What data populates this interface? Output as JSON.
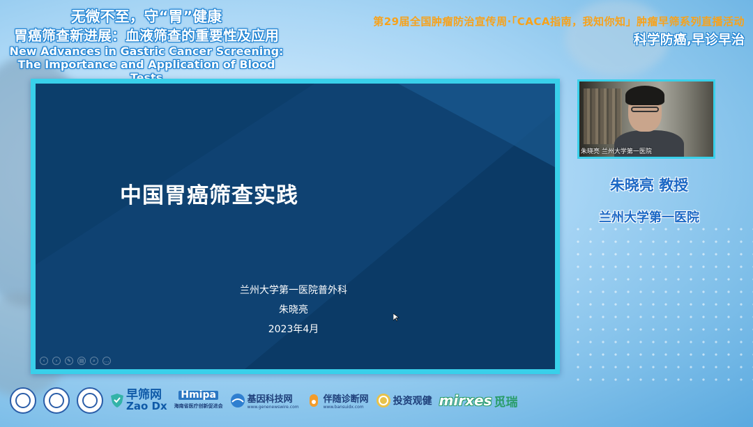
{
  "header": {
    "left_line1": "无微不至，守“胃”健康",
    "left_line2": "胃癌筛查新进展：血液筛查的重要性及应用",
    "left_line3": "New Advances in Gastric Cancer Screening:",
    "left_line4": "The Importance and Application of Blood Tests",
    "right_line1": "第29届全国肿瘤防治宣传周·「CACA指南，我知你知」肿瘤早筛系列直播活动",
    "right_line2": "科学防癌,早诊早治"
  },
  "slide": {
    "title": "中国胃癌筛查实践",
    "institution": "兰州大学第一医院普外科",
    "presenter": "朱晓亮",
    "date": "2023年4月",
    "toolbar_icons": [
      "prev-icon",
      "next-icon",
      "pen-icon",
      "slides-icon",
      "zoom-icon",
      "more-icon"
    ]
  },
  "video": {
    "caption": "朱晓亮 兰州大学第一医院"
  },
  "speaker": {
    "name": "朱晓亮 教授",
    "affiliation": "兰州大学第一医院"
  },
  "sponsors": {
    "zao_cn": "早筛网",
    "zao_en": "Zao Dx",
    "hmipa": "Hmipa",
    "hmipa_sub": "海南省医疗创新促进会",
    "gene": "基因科技网",
    "gene_url": "www.genenewswire.com",
    "bansui": "伴随诊断网",
    "bansui_url": "www.bansuidx.com",
    "invest": "投资观健",
    "mirxes": "mirxes",
    "mirxes_cn": "觅瑞"
  },
  "colors": {
    "slide_bg": "#0d3f6c",
    "frame_accent": "#39d0ea",
    "title_orange": "#f7a21b",
    "speaker_blue": "#1c68c5"
  }
}
